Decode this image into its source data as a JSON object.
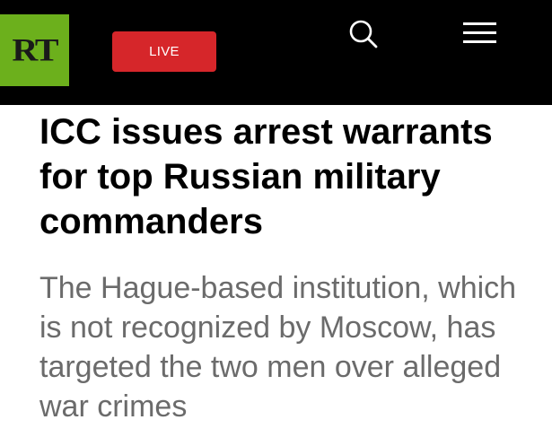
{
  "header": {
    "logo_text": "RT",
    "live_label": "LIVE",
    "search_icon": "search-icon",
    "menu_icon": "hamburger-menu-icon"
  },
  "article": {
    "headline": "ICC issues arrest warrants for top Russian military commanders",
    "summary": "The Hague-based institution, which is not recognized by Moscow, has targeted the two men over alleged war crimes"
  },
  "colors": {
    "header_background": "#000000",
    "logo_background": "#6cb01c",
    "live_button": "#d6262a",
    "headline_text": "#000000",
    "summary_text": "#6b6b6b"
  }
}
